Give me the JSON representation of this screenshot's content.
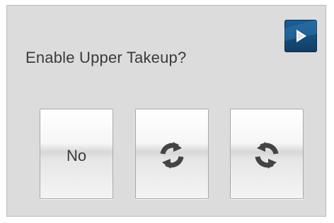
{
  "dialog": {
    "prompt": "Enable Upper Takeup?",
    "play_button": {
      "icon": "play-icon",
      "color": "#1c5f95"
    },
    "options": [
      {
        "kind": "text",
        "label": "No"
      },
      {
        "kind": "icon",
        "icon": "refresh-icon"
      },
      {
        "kind": "icon",
        "icon": "refresh-reverse-icon"
      }
    ]
  },
  "colors": {
    "background": "#dcdcdc",
    "text": "#3a3a3a",
    "icon": "#444444"
  }
}
